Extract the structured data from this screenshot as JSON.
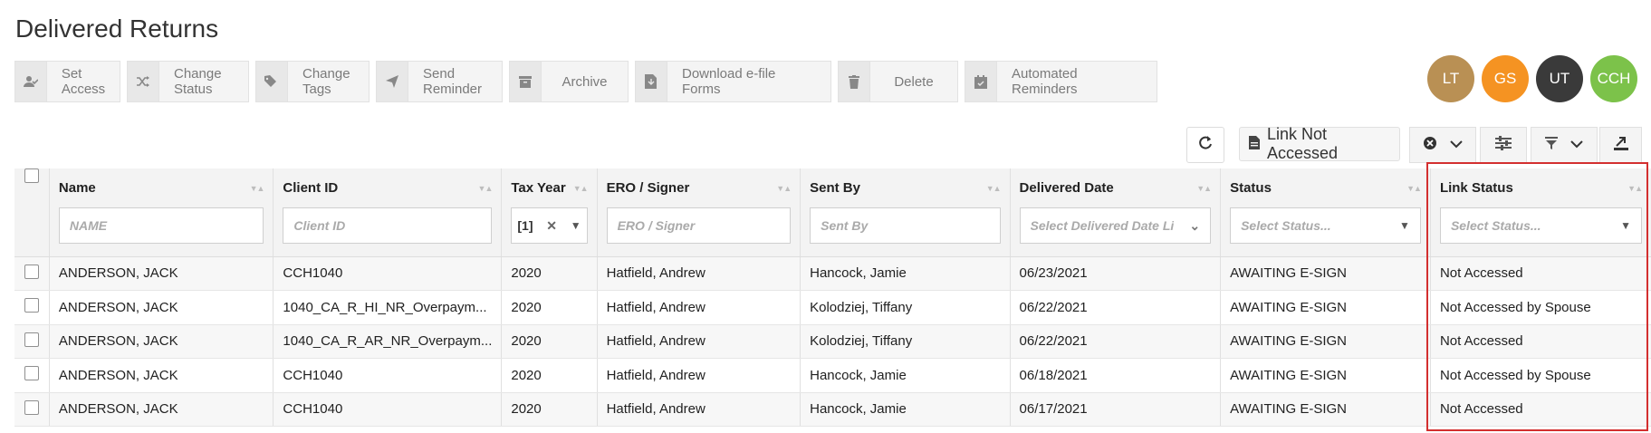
{
  "page": {
    "title": "Delivered Returns"
  },
  "toolbar": [
    {
      "label": "Set Access",
      "icon": "user-check-icon"
    },
    {
      "label": "Change Status",
      "icon": "shuffle-icon"
    },
    {
      "label": "Change Tags",
      "icon": "tags-icon"
    },
    {
      "label": "Send Reminder",
      "icon": "paper-plane-icon"
    },
    {
      "label": "Archive",
      "icon": "archive-icon"
    },
    {
      "label": "Download e-file Forms",
      "icon": "file-download-icon"
    },
    {
      "label": "Delete",
      "icon": "trash-icon"
    },
    {
      "label": "Automated Reminders",
      "icon": "calendar-check-icon"
    }
  ],
  "avatars": [
    {
      "initials": "LT",
      "color": "#b99054"
    },
    {
      "initials": "GS",
      "color": "#f59322"
    },
    {
      "initials": "UT",
      "color": "#3a3a3a"
    },
    {
      "initials": "CCH",
      "color": "#7cc24a"
    }
  ],
  "filter_chip": {
    "label": "Link Not Accessed"
  },
  "columns": [
    {
      "label": "Name",
      "placeholder": "NAME"
    },
    {
      "label": "Client ID",
      "placeholder": "Client ID"
    },
    {
      "label": "Tax Year",
      "value": "[1]"
    },
    {
      "label": "ERO / Signer",
      "placeholder": "ERO / Signer"
    },
    {
      "label": "Sent By",
      "placeholder": "Sent By"
    },
    {
      "label": "Delivered Date",
      "placeholder": "Select Delivered Date Li"
    },
    {
      "label": "Status",
      "placeholder": "Select Status..."
    },
    {
      "label": "Link Status",
      "placeholder": "Select Status..."
    }
  ],
  "rows": [
    {
      "name": "ANDERSON, JACK",
      "client_id": "CCH1040",
      "tax_year": "2020",
      "ero": "Hatfield, Andrew",
      "sent_by": "Hancock, Jamie",
      "delivered": "06/23/2021",
      "status": "AWAITING E-SIGN",
      "link_status": "Not Accessed"
    },
    {
      "name": "ANDERSON, JACK",
      "client_id": "1040_CA_R_HI_NR_Overpaym...",
      "tax_year": "2020",
      "ero": "Hatfield, Andrew",
      "sent_by": "Kolodziej, Tiffany",
      "delivered": "06/22/2021",
      "status": "AWAITING E-SIGN",
      "link_status": "Not Accessed by Spouse"
    },
    {
      "name": "ANDERSON, JACK",
      "client_id": "1040_CA_R_AR_NR_Overpaym...",
      "tax_year": "2020",
      "ero": "Hatfield, Andrew",
      "sent_by": "Kolodziej, Tiffany",
      "delivered": "06/22/2021",
      "status": "AWAITING E-SIGN",
      "link_status": "Not Accessed"
    },
    {
      "name": "ANDERSON, JACK",
      "client_id": "CCH1040",
      "tax_year": "2020",
      "ero": "Hatfield, Andrew",
      "sent_by": "Hancock, Jamie",
      "delivered": "06/18/2021",
      "status": "AWAITING E-SIGN",
      "link_status": "Not Accessed by Spouse"
    },
    {
      "name": "ANDERSON, JACK",
      "client_id": "CCH1040",
      "tax_year": "2020",
      "ero": "Hatfield, Andrew",
      "sent_by": "Hancock, Jamie",
      "delivered": "06/17/2021",
      "status": "AWAITING E-SIGN",
      "link_status": "Not Accessed"
    }
  ]
}
